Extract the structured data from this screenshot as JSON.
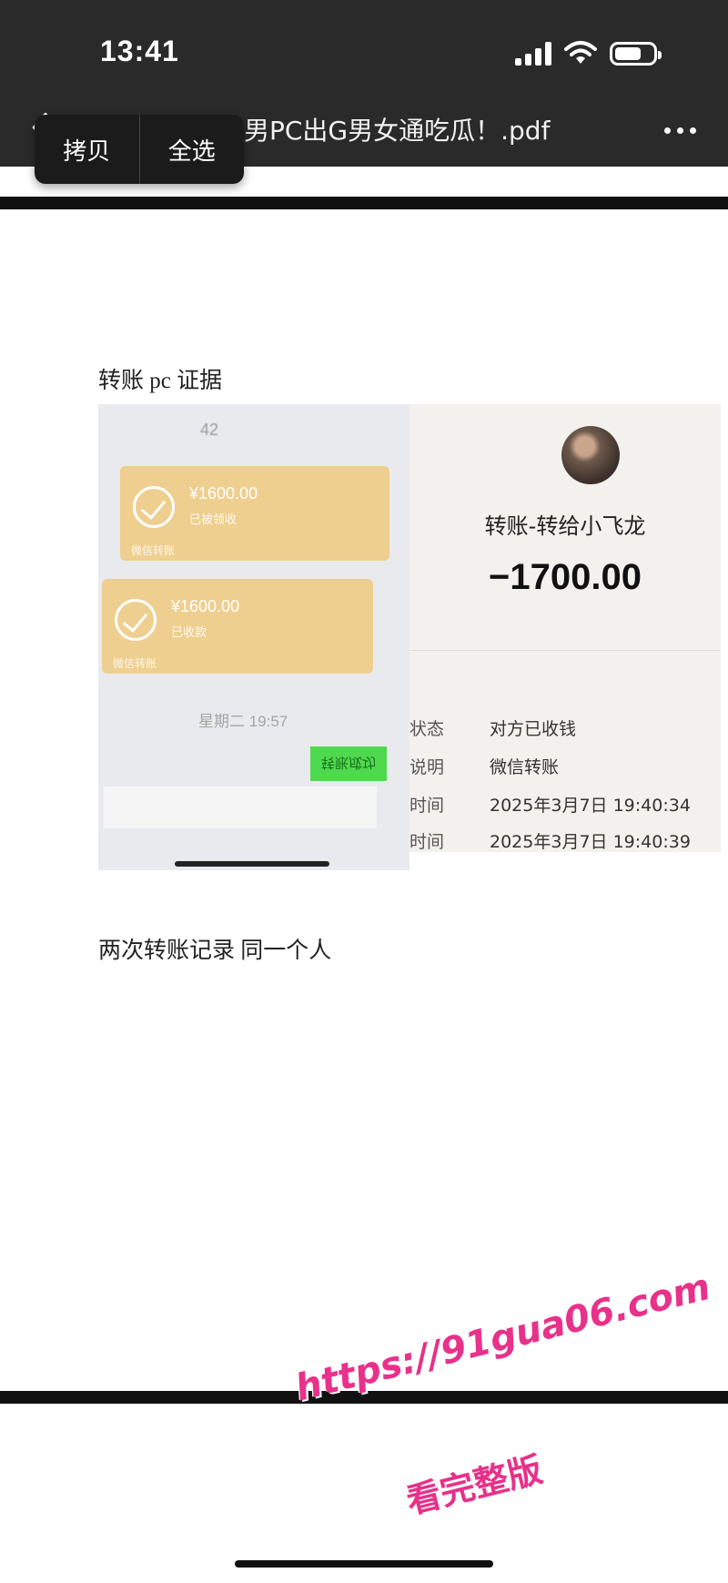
{
  "status_bar": {
    "time": "13:41"
  },
  "header": {
    "doc_title": "男PC出G男女通吃瓜！.pdf"
  },
  "context_menu": {
    "items": [
      {
        "label": "拷贝"
      },
      {
        "label": "全选"
      }
    ]
  },
  "document": {
    "heading": "转账 pc 证据",
    "caption": "两次转账记录  同一个人",
    "evidence_left": {
      "blurred_name": "42",
      "cards": [
        {
          "amount": "¥1600.00",
          "status": "已被领收",
          "footer": "微信转账"
        },
        {
          "amount": "¥1600.00",
          "status": "已收款",
          "footer": "微信转账"
        }
      ],
      "chat_time": "星期二 19:57",
      "button": "转账成功"
    },
    "evidence_right": {
      "title": "转账-转给小飞龙",
      "amount": "−1700.00",
      "rows": [
        {
          "key": "状态",
          "value": "对方已收钱"
        },
        {
          "key": "说明",
          "value": "微信转账"
        },
        {
          "key": "时间",
          "value": "2025年3月7日 19:40:34"
        },
        {
          "key": "时间",
          "value": "2025年3月7日 19:40:39"
        }
      ]
    }
  },
  "watermark": {
    "url": "https://91gua06.com",
    "text": "看完整版",
    "color": "#e8318a"
  }
}
